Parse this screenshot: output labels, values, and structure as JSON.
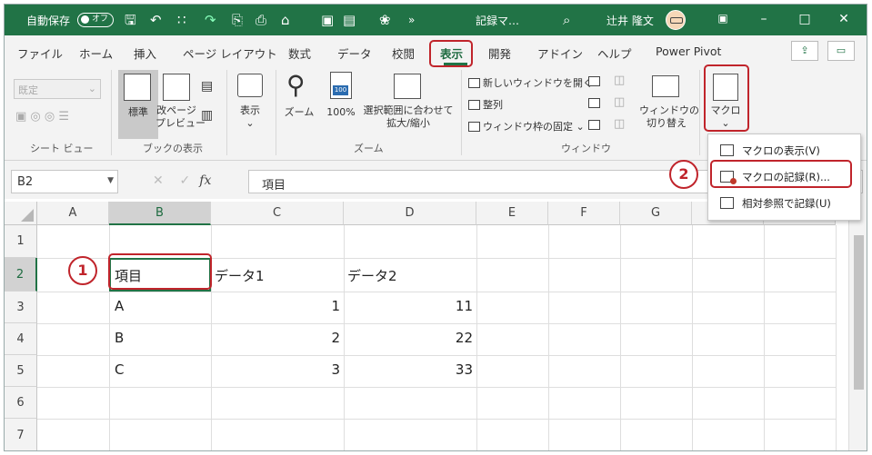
{
  "titlebar": {
    "autosave_label": "自動保存",
    "autosave_state": "オフ",
    "doc_title": "記録マ… ",
    "user_name": "辻井 隆文"
  },
  "tabs": [
    {
      "label": "ファイル"
    },
    {
      "label": "ホーム"
    },
    {
      "label": "挿入"
    },
    {
      "label": "ページ レイアウト"
    },
    {
      "label": "数式"
    },
    {
      "label": "データ"
    },
    {
      "label": "校閲"
    },
    {
      "label": "表示"
    },
    {
      "label": "開発"
    },
    {
      "label": "アドイン"
    },
    {
      "label": "ヘルプ"
    },
    {
      "label": "Power Pivot"
    }
  ],
  "ribbon": {
    "sheet_view": {
      "dropdown": "既定",
      "group": "シート ビュー"
    },
    "book_view": {
      "normal": "標準",
      "page_break_1": "改ページ",
      "page_break_2": "プレビュー",
      "group": "ブックの表示"
    },
    "show": {
      "label": "表示"
    },
    "zoom": {
      "zoom": "ズーム",
      "hundred": "100%",
      "selection_1": "選択範囲に合わせて",
      "selection_2": "拡大/縮小",
      "icon_text": "100",
      "group": "ズーム"
    },
    "window": {
      "new_window": "新しいウィンドウを開く",
      "arrange": "整列",
      "freeze": "ウィンドウ枠の固定",
      "switch_1": "ウィンドウの",
      "switch_2": "切り替え",
      "group": "ウィンドウ"
    },
    "macro": {
      "label": "マクロ"
    }
  },
  "formula_bar": {
    "name_box": "B2",
    "formula": "項目"
  },
  "grid": {
    "columns": [
      "A",
      "B",
      "C",
      "D",
      "E",
      "F",
      "G"
    ],
    "rows": [
      "1",
      "2",
      "3",
      "4",
      "5",
      "6",
      "7"
    ],
    "cells": {
      "B2": "項目",
      "C2": "データ1",
      "D2": "データ2",
      "B3": "A",
      "C3": "1",
      "D3": "11",
      "B4": "B",
      "C4": "2",
      "D4": "22",
      "B5": "C",
      "C5": "3",
      "D5": "33"
    }
  },
  "macro_menu": {
    "items": [
      {
        "label": "マクロの表示(V)"
      },
      {
        "label": "マクロの記録(R)..."
      },
      {
        "label": "相対参照で記録(U)"
      }
    ]
  },
  "annotations": {
    "step1": "1",
    "step2": "2",
    "color": "#c0242b"
  },
  "colors": {
    "accent": "#217346",
    "highlight": "#c0242b"
  }
}
